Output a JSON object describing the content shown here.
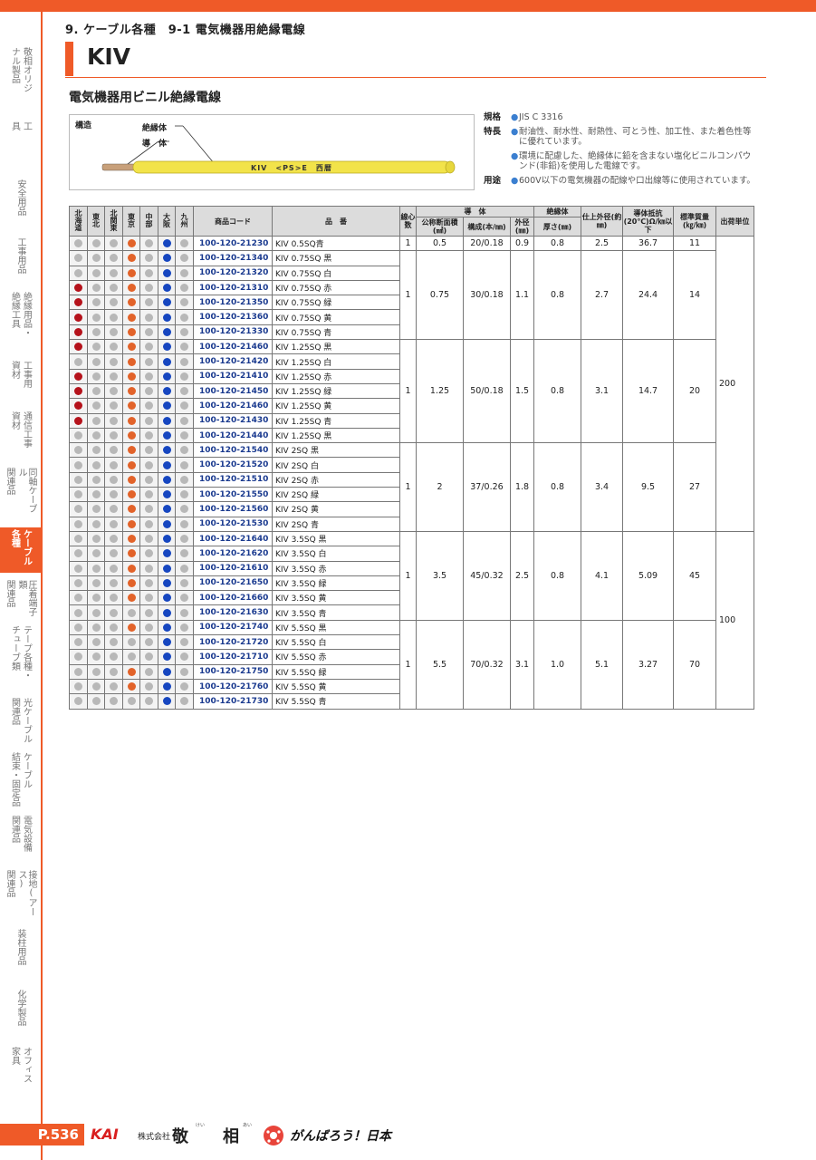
{
  "breadcrumb": "9. ケーブル各種　9-1 電気機器用絶縁電線",
  "title": "KIV",
  "subtitle": "電気機器用ビニル絶縁電線",
  "sidebar": {
    "items": [
      {
        "lines": [
          "敬相オリジ",
          "ナル製品"
        ],
        "active": false
      },
      {
        "lines": [
          "工",
          "具"
        ],
        "active": false
      },
      {
        "lines": [
          "安全用品"
        ],
        "active": false
      },
      {
        "lines": [
          "工事用品"
        ],
        "active": false
      },
      {
        "lines": [
          "絶縁用品・",
          "絶縁工具"
        ],
        "active": false
      },
      {
        "lines": [
          "工事用",
          "資材"
        ],
        "active": false
      },
      {
        "lines": [
          "通信工事",
          "資材"
        ],
        "active": false
      },
      {
        "lines": [
          "同軸ケーブル",
          "関連品"
        ],
        "active": false
      },
      {
        "lines": [
          "ケーブル",
          "各種"
        ],
        "active": true
      },
      {
        "lines": [
          "圧着端子類",
          "関連品"
        ],
        "active": false
      },
      {
        "lines": [
          "テープ各種・",
          "チューブ類"
        ],
        "active": false
      },
      {
        "lines": [
          "光ケーブル",
          "関連品"
        ],
        "active": false
      },
      {
        "lines": [
          "ケーブル",
          "結束・固定品"
        ],
        "active": false
      },
      {
        "lines": [
          "電気設備",
          "関連品"
        ],
        "active": false
      },
      {
        "lines": [
          "接地(アース)",
          "関連品"
        ],
        "active": false
      },
      {
        "lines": [
          "装柱用品"
        ],
        "active": false
      },
      {
        "lines": [
          "化学製品"
        ],
        "active": false
      },
      {
        "lines": [
          "オフィス",
          "家具"
        ],
        "active": false
      }
    ]
  },
  "structure": {
    "label": "構造",
    "insulation_label": "絶縁体",
    "conductor_label": "導　体",
    "cable_print": "KIV　<PS>E　西暦",
    "cable_color": "#f2e34a"
  },
  "specs": [
    {
      "key": "規格",
      "value": "JIS C 3316"
    },
    {
      "key": "特長",
      "value": "耐油性、耐水性、耐熱性、可とう性、加工性、また着色性等に優れています。"
    },
    {
      "key": "",
      "value": "環境に配慮した、絶縁体に鉛を含まない塩化ビニルコンパウンド(非鉛)を使用した電線です。"
    },
    {
      "key": "用途",
      "value": "600V以下の電気機器の配線や口出線等に使用されています。"
    }
  ],
  "colors": {
    "accent": "#ef5a28",
    "dot_red": "#b5121b",
    "dot_gray": "#b8b8b8",
    "dot_orange": "#e2632a",
    "dot_blue": "#1646c0",
    "code_blue": "#1a3a8f"
  },
  "table": {
    "headers": {
      "regions": [
        "北海道",
        "東北",
        "北関東",
        "東京",
        "中部",
        "大阪",
        "九州"
      ],
      "code": "商品コード",
      "name": "品　番",
      "cores": "線心数",
      "conductor": "導　体",
      "area": "公称断面積(㎟)",
      "construction": "構成(本/㎜)",
      "diameter": "外径(㎜)",
      "insulation": "絶縁体",
      "thickness": "厚さ(㎜)",
      "finish": "仕上外径(約㎜)",
      "resistance": "導体抵抗(20℃)Ω/㎞以下",
      "weight": "標準質量(㎏/㎞)",
      "unit": "出荷単位"
    },
    "groups": [
      {
        "cores": "1",
        "area": "0.5",
        "construction": "20/0.18",
        "diameter": "0.9",
        "thickness": "0.8",
        "finish": "2.5",
        "resistance": "36.7",
        "weight": "11",
        "rows": [
          {
            "code": "100-120-21230",
            "name": "KIV 0.5SQ青",
            "dots": [
              "g",
              "g",
              "g",
              "o",
              "g",
              "b",
              "g"
            ]
          }
        ]
      },
      {
        "cores": "1",
        "area": "0.75",
        "construction": "30/0.18",
        "diameter": "1.1",
        "thickness": "0.8",
        "finish": "2.7",
        "resistance": "24.4",
        "weight": "14",
        "rows": [
          {
            "code": "100-120-21340",
            "name": "KIV 0.75SQ 黒",
            "dots": [
              "g",
              "g",
              "g",
              "o",
              "g",
              "b",
              "g"
            ]
          },
          {
            "code": "100-120-21320",
            "name": "KIV 0.75SQ 白",
            "dots": [
              "g",
              "g",
              "g",
              "o",
              "g",
              "b",
              "g"
            ]
          },
          {
            "code": "100-120-21310",
            "name": "KIV 0.75SQ 赤",
            "dots": [
              "r",
              "g",
              "g",
              "o",
              "g",
              "b",
              "g"
            ]
          },
          {
            "code": "100-120-21350",
            "name": "KIV 0.75SQ 緑",
            "dots": [
              "r",
              "g",
              "g",
              "o",
              "g",
              "b",
              "g"
            ]
          },
          {
            "code": "100-120-21360",
            "name": "KIV 0.75SQ 黄",
            "dots": [
              "r",
              "g",
              "g",
              "o",
              "g",
              "b",
              "g"
            ]
          },
          {
            "code": "100-120-21330",
            "name": "KIV 0.75SQ 青",
            "dots": [
              "r",
              "g",
              "g",
              "o",
              "g",
              "b",
              "g"
            ]
          }
        ]
      },
      {
        "cores": "1",
        "area": "1.25",
        "construction": "50/0.18",
        "diameter": "1.5",
        "thickness": "0.8",
        "finish": "3.1",
        "resistance": "14.7",
        "weight": "20",
        "rows": [
          {
            "code": "100-120-21460",
            "name": "KIV 1.25SQ 黒",
            "dots": [
              "r",
              "g",
              "g",
              "o",
              "g",
              "b",
              "g"
            ]
          },
          {
            "code": "100-120-21420",
            "name": "KIV 1.25SQ 白",
            "dots": [
              "g",
              "g",
              "g",
              "o",
              "g",
              "b",
              "g"
            ]
          },
          {
            "code": "100-120-21410",
            "name": "KIV 1.25SQ 赤",
            "dots": [
              "r",
              "g",
              "g",
              "o",
              "g",
              "b",
              "g"
            ]
          },
          {
            "code": "100-120-21450",
            "name": "KIV 1.25SQ 緑",
            "dots": [
              "r",
              "g",
              "g",
              "o",
              "g",
              "b",
              "g"
            ]
          },
          {
            "code": "100-120-21460",
            "name": "KIV 1.25SQ 黄",
            "dots": [
              "r",
              "g",
              "g",
              "o",
              "g",
              "b",
              "g"
            ]
          },
          {
            "code": "100-120-21430",
            "name": "KIV 1.25SQ 青",
            "dots": [
              "r",
              "g",
              "g",
              "o",
              "g",
              "b",
              "g"
            ]
          },
          {
            "code": "100-120-21440",
            "name": "KIV 1.25SQ 黒",
            "dots": [
              "g",
              "g",
              "g",
              "o",
              "g",
              "b",
              "g"
            ]
          }
        ]
      },
      {
        "cores": "1",
        "area": "2",
        "construction": "37/0.26",
        "diameter": "1.8",
        "thickness": "0.8",
        "finish": "3.4",
        "resistance": "9.5",
        "weight": "27",
        "rows": [
          {
            "code": "100-120-21540",
            "name": "KIV 2SQ 黒",
            "dots": [
              "g",
              "g",
              "g",
              "o",
              "g",
              "b",
              "g"
            ]
          },
          {
            "code": "100-120-21520",
            "name": "KIV 2SQ 白",
            "dots": [
              "g",
              "g",
              "g",
              "o",
              "g",
              "b",
              "g"
            ]
          },
          {
            "code": "100-120-21510",
            "name": "KIV 2SQ 赤",
            "dots": [
              "g",
              "g",
              "g",
              "o",
              "g",
              "b",
              "g"
            ]
          },
          {
            "code": "100-120-21550",
            "name": "KIV 2SQ 緑",
            "dots": [
              "g",
              "g",
              "g",
              "o",
              "g",
              "b",
              "g"
            ]
          },
          {
            "code": "100-120-21560",
            "name": "KIV 2SQ 黄",
            "dots": [
              "g",
              "g",
              "g",
              "o",
              "g",
              "b",
              "g"
            ]
          },
          {
            "code": "100-120-21530",
            "name": "KIV 2SQ 青",
            "dots": [
              "g",
              "g",
              "g",
              "o",
              "g",
              "b",
              "g"
            ]
          }
        ]
      },
      {
        "cores": "1",
        "area": "3.5",
        "construction": "45/0.32",
        "diameter": "2.5",
        "thickness": "0.8",
        "finish": "4.1",
        "resistance": "5.09",
        "weight": "45",
        "rows": [
          {
            "code": "100-120-21640",
            "name": "KIV 3.5SQ 黒",
            "dots": [
              "g",
              "g",
              "g",
              "o",
              "g",
              "b",
              "g"
            ]
          },
          {
            "code": "100-120-21620",
            "name": "KIV 3.5SQ 白",
            "dots": [
              "g",
              "g",
              "g",
              "o",
              "g",
              "b",
              "g"
            ]
          },
          {
            "code": "100-120-21610",
            "name": "KIV 3.5SQ 赤",
            "dots": [
              "g",
              "g",
              "g",
              "o",
              "g",
              "b",
              "g"
            ]
          },
          {
            "code": "100-120-21650",
            "name": "KIV 3.5SQ 緑",
            "dots": [
              "g",
              "g",
              "g",
              "o",
              "g",
              "b",
              "g"
            ]
          },
          {
            "code": "100-120-21660",
            "name": "KIV 3.5SQ 黄",
            "dots": [
              "g",
              "g",
              "g",
              "o",
              "g",
              "b",
              "g"
            ]
          },
          {
            "code": "100-120-21630",
            "name": "KIV 3.5SQ 青",
            "dots": [
              "g",
              "g",
              "g",
              "g",
              "g",
              "b",
              "g"
            ]
          }
        ]
      },
      {
        "cores": "1",
        "area": "5.5",
        "construction": "70/0.32",
        "diameter": "3.1",
        "thickness": "1.0",
        "finish": "5.1",
        "resistance": "3.27",
        "weight": "70",
        "rows": [
          {
            "code": "100-120-21740",
            "name": "KIV 5.5SQ 黒",
            "dots": [
              "g",
              "g",
              "g",
              "o",
              "g",
              "b",
              "g"
            ]
          },
          {
            "code": "100-120-21720",
            "name": "KIV 5.5SQ 白",
            "dots": [
              "g",
              "g",
              "g",
              "g",
              "g",
              "b",
              "g"
            ]
          },
          {
            "code": "100-120-21710",
            "name": "KIV 5.5SQ 赤",
            "dots": [
              "g",
              "g",
              "g",
              "g",
              "g",
              "b",
              "g"
            ]
          },
          {
            "code": "100-120-21750",
            "name": "KIV 5.5SQ 緑",
            "dots": [
              "g",
              "g",
              "g",
              "o",
              "g",
              "b",
              "g"
            ]
          },
          {
            "code": "100-120-21760",
            "name": "KIV 5.5SQ 黄",
            "dots": [
              "g",
              "g",
              "g",
              "o",
              "g",
              "b",
              "g"
            ]
          },
          {
            "code": "100-120-21730",
            "name": "KIV 5.5SQ 青",
            "dots": [
              "g",
              "g",
              "g",
              "g",
              "g",
              "b",
              "g"
            ]
          }
        ]
      }
    ],
    "units": [
      {
        "value": "200",
        "rows": 20
      },
      {
        "value": "100",
        "rows": 12
      }
    ]
  },
  "footer": {
    "page": "P.536",
    "logo": "KAI",
    "company_prefix": "株式会社",
    "company_kei": "敬",
    "company_sou": "相",
    "ruby_kei": "けい",
    "ruby_sou": "あい",
    "slogan": "がんばろう！日本"
  }
}
